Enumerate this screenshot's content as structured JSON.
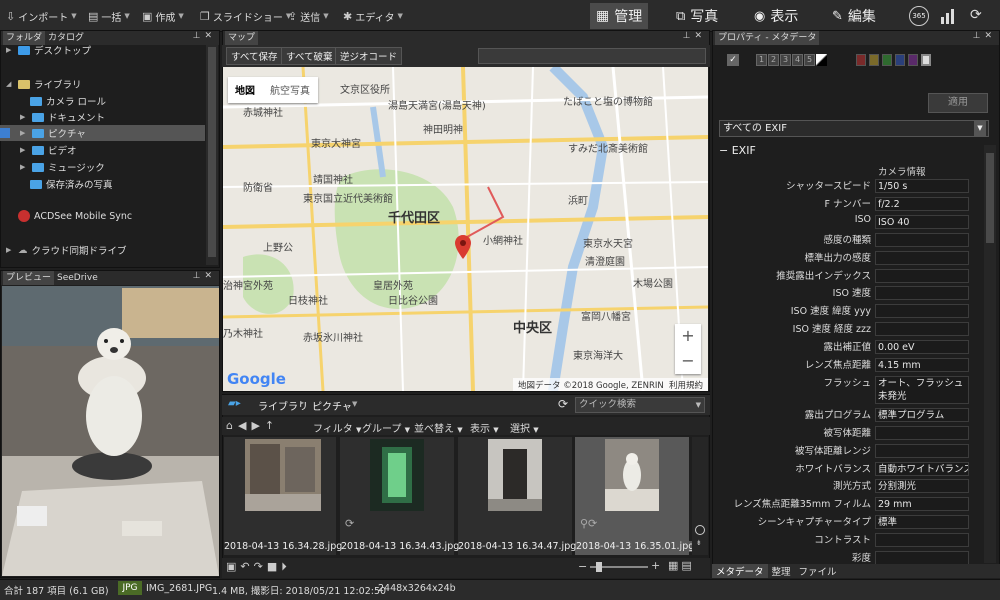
{
  "toolbar": {
    "import": "インポート",
    "batch": "一括",
    "create": "作成",
    "slideshow": "スライドショー",
    "send": "送信",
    "editor": "エディタ"
  },
  "modes": {
    "manage": "管理",
    "photos": "写真",
    "view": "表示",
    "edit": "編集",
    "badge365": "365"
  },
  "folders": {
    "tab_folder": "フォルダ",
    "tab_catalog": "カタログ",
    "items": {
      "desktop": "デスクトップ",
      "library": "ライブラリ",
      "camera_roll": "カメラ ロール",
      "documents": "ドキュメント",
      "pictures": "ピクチャ",
      "videos": "ビデオ",
      "music": "ミュージック",
      "saved_pictures": "保存済みの写真",
      "mobile_sync": "ACDSee Mobile Sync",
      "cloud": "クラウド同期ドライブ"
    }
  },
  "preview": {
    "tab_preview": "プレビュー",
    "tab_seedrive": "SeeDrive"
  },
  "map": {
    "tab": "マップ",
    "save_all": "すべて保存",
    "discard_all": "すべて破棄",
    "reverse_geocode": "逆ジオコード",
    "type_map": "地図",
    "type_aerial": "航空写真",
    "attribution": "地図データ ©2018 Google, ZENRIN",
    "terms": "利用規約",
    "zoom_in": "+",
    "zoom_out": "−",
    "google": "Google",
    "labels": {
      "chiyoda": "千代田区",
      "chuo": "中央区",
      "bunkyo": "文京区役所",
      "yushima": "湯島天満宮(湯島天神)",
      "tabako": "たばこと塩の博物館",
      "akagi": "赤城神社",
      "kanda_myojin": "神田明神",
      "sumida": "すみだ北斎美術館",
      "tokyo_daijingu": "東京大神宮",
      "yasukuni": "靖国神社",
      "bousai": "防衛省",
      "kogeikan": "東京国立近代美術館",
      "kokyo": "皇居東御苑",
      "hama": "浜町",
      "meijijingu_gaien": "治神宮外苑",
      "nezu_jinja": "日枝神社",
      "kokyo_gaien": "皇居外苑",
      "hibiya": "日比谷公園",
      "tokyo_eki": "東京駅",
      "tokyo_stn_kosen": "東京水天宮",
      "kiyosumi": "清澄庭園",
      "kibaba": "木場公園",
      "tomioka": "富岡八幡宮",
      "etchujima": "江東区",
      "nogizaka": "乃木神社",
      "akasaka": "赤坂氷川神社",
      "kaiyo": "東京海洋大",
      "ueno": "上野公",
      "jinbocho": "神田明神",
      "kobe": "小網神社",
      "mitsukoshi": "三越前"
    }
  },
  "browser": {
    "crumb_library": "ライブラリ",
    "crumb_pictures": "ピクチャ",
    "search_placeholder": "クイック検索",
    "filter": "フィルタ",
    "group": "グループ",
    "sort": "並べ替え",
    "view": "表示",
    "select": "選択",
    "thumbs": [
      "2018-04-13 16.34.28.jpg",
      "2018-04-13 16.34.43.jpg",
      "2018-04-13 16.34.47.jpg",
      "2018-04-13 16.35.01.jpg"
    ]
  },
  "properties": {
    "tab": "プロパティ - メタデータ",
    "ratings": [
      "1",
      "2",
      "3",
      "4",
      "5"
    ],
    "apply": "適用",
    "exif_select": "すべての EXIF",
    "section": "EXIF",
    "camera_info": "カメラ情報",
    "rows": [
      {
        "k": "シャッタースピード",
        "v": "1/50 s"
      },
      {
        "k": "F ナンバー",
        "v": "f/2.2"
      },
      {
        "k": "ISO",
        "v": "ISO 40"
      },
      {
        "k": "感度の種類",
        "v": ""
      },
      {
        "k": "標準出力の感度",
        "v": ""
      },
      {
        "k": "推奨露出インデックス",
        "v": ""
      },
      {
        "k": "ISO 速度",
        "v": ""
      },
      {
        "k": "ISO 速度 緯度 yyy",
        "v": ""
      },
      {
        "k": "ISO 速度 経度 zzz",
        "v": ""
      },
      {
        "k": "露出補正値",
        "v": "0.00 eV"
      },
      {
        "k": "レンズ焦点距離",
        "v": "4.15 mm"
      },
      {
        "k": "フラッシュ",
        "v": "オート、フラッシュ未発光"
      },
      {
        "k": "露出プログラム",
        "v": "標準プログラム"
      },
      {
        "k": "被写体距離",
        "v": ""
      },
      {
        "k": "被写体距離レンジ",
        "v": ""
      },
      {
        "k": "ホワイトバランス",
        "v": "自動ホワイトバランス"
      },
      {
        "k": "測光方式",
        "v": "分割測光"
      },
      {
        "k": "レンズ焦点距離35mm フィルム",
        "v": "29 mm"
      },
      {
        "k": "シーンキャプチャータイプ",
        "v": "標準"
      },
      {
        "k": "コントラスト",
        "v": ""
      },
      {
        "k": "彩度",
        "v": ""
      }
    ],
    "tabs": {
      "metadata": "メタデータ",
      "organize": "整理",
      "file": "ファイル"
    }
  },
  "status": {
    "total": "合計 187 項目 (6.1 GB)",
    "format": "JPG",
    "filename": "IMG_2681.JPG",
    "info": "1.4 MB, 撮影日: 2018/05/21 12:02:50",
    "dims": "2448x3264x24b"
  }
}
